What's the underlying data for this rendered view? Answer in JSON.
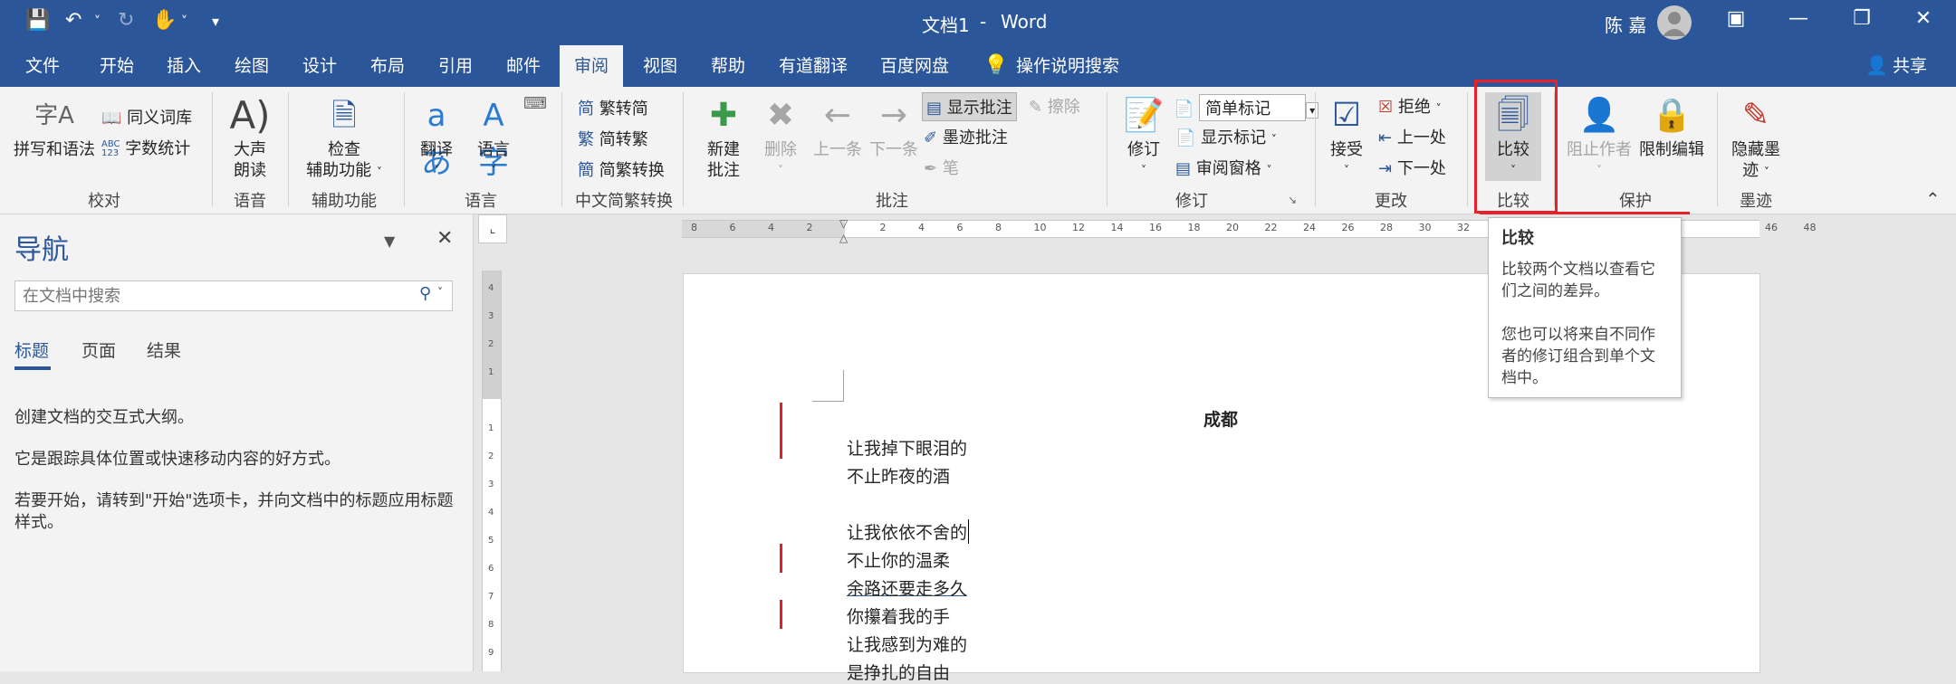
{
  "titlebar": {
    "doc_title": "文档1",
    "separator": "-",
    "app": "Word",
    "user": "陈 嘉"
  },
  "tabs": [
    "文件",
    "开始",
    "插入",
    "绘图",
    "设计",
    "布局",
    "引用",
    "邮件",
    "审阅",
    "视图",
    "帮助",
    "有道翻译",
    "百度网盘",
    "操作说明搜索"
  ],
  "share": "共享",
  "ribbon": {
    "proofing": {
      "spell": "拼写和语法",
      "thesaurus": "同义词库",
      "wordcount": "字数统计",
      "group": "校对",
      "abc": "ABC",
      "num": "123",
      "zi": "字A"
    },
    "speech": {
      "read_1": "大声",
      "read_2": "朗读",
      "group": "语音"
    },
    "access": {
      "check_1": "检查",
      "check_2": "辅助功能",
      "group": "辅助功能"
    },
    "language": {
      "translate": "翻译",
      "language": "语言",
      "group": "语言"
    },
    "chinese": {
      "t2s": "繁转简",
      "s2t": "简转繁",
      "convert": "简繁转换",
      "group": "中文简繁转换"
    },
    "comments": {
      "new_1": "新建",
      "new_2": "批注",
      "delete": "删除",
      "prev": "上一条",
      "next": "下一条",
      "show": "显示批注",
      "erase": "擦除",
      "ink": "墨迹批注",
      "pen": "笔",
      "group": "批注"
    },
    "tracking": {
      "track": "修订",
      "simple": "简单标记",
      "show_markup": "显示标记",
      "pane": "审阅窗格",
      "group": "修订"
    },
    "changes": {
      "accept": "接受",
      "reject": "拒绝",
      "prev": "上一处",
      "next": "下一处",
      "group": "更改"
    },
    "compare": {
      "compare": "比较",
      "group": "比较"
    },
    "protect": {
      "block": "阻止作者",
      "restrict": "限制编辑",
      "group": "保护"
    },
    "ink": {
      "hide_1": "隐藏墨",
      "hide_2": "迹",
      "group": "墨迹"
    }
  },
  "nav": {
    "title": "导航",
    "search_placeholder": "在文档中搜索",
    "tabs": [
      "标题",
      "页面",
      "结果"
    ],
    "p1": "创建文档的交互式大纲。",
    "p2": "它是跟踪具体位置或快速移动内容的好方式。",
    "p3a": "若要开始，请转到\"开始\"选项卡，并向文档中的标题应用标题",
    "p3b": "样式。"
  },
  "ruler": {
    "left_ticks": [
      "8",
      "6",
      "4",
      "2"
    ],
    "right_ticks": [
      "2",
      "4",
      "6",
      "8",
      "10",
      "12",
      "14",
      "16",
      "18",
      "20",
      "22",
      "24",
      "26",
      "28",
      "30",
      "32",
      "",
      "",
      "",
      "",
      "",
      "",
      "",
      "46",
      "48"
    ],
    "vticks": [
      "4",
      "3",
      "2",
      "1",
      "",
      "1",
      "2",
      "3",
      "4",
      "5",
      "6",
      "7",
      "8",
      "9"
    ]
  },
  "doc": {
    "title": "成都",
    "lines": [
      "让我掉下眼泪的",
      "不止昨夜的酒",
      "",
      "让我依依不舍的",
      "不止你的温柔",
      "余路还要走多久",
      "你攥着我的手",
      "让我感到为难的",
      "是挣扎的自由"
    ]
  },
  "tooltip": {
    "title": "比较",
    "l1": "比较两个文档以查看它",
    "l2": "们之间的差异。",
    "l3": "您也可以将来自不同作",
    "l4": "者的修订组合到单个文",
    "l5": "档中。"
  },
  "colors": {
    "word_blue": "#2b579a",
    "highlight_red": "#e8202a",
    "revision_bar": "#e02030"
  }
}
